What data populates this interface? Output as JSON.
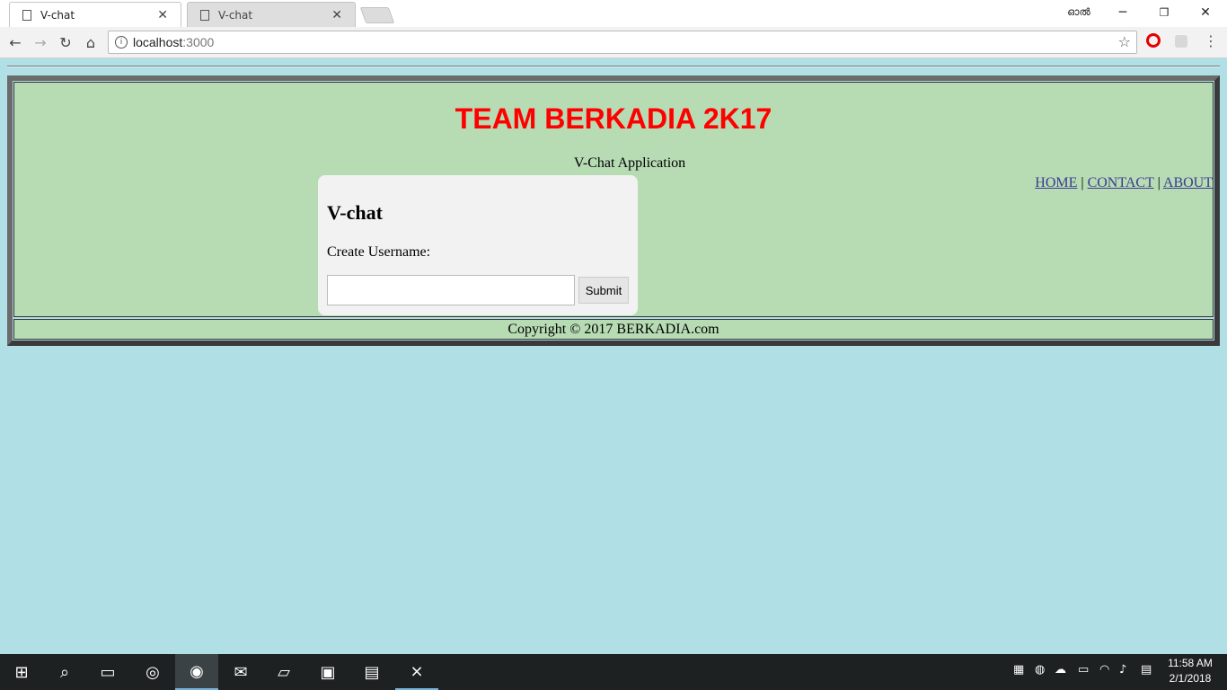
{
  "browser": {
    "tabs": [
      {
        "label": "V-chat",
        "active": true
      },
      {
        "label": "V-chat",
        "active": false
      }
    ],
    "profile_label": "ഓൽ",
    "address": {
      "host": "localhost",
      "port": ":3000"
    }
  },
  "page": {
    "title": "TEAM BERKADIA 2K17",
    "subtitle": "V-Chat Application",
    "nav": {
      "home": "HOME",
      "contact": "CONTACT",
      "about": "ABOUT",
      "separator": "|"
    },
    "card": {
      "heading": "V-chat",
      "label": "Create Username:",
      "input_value": "",
      "submit_label": "Submit"
    },
    "footer": "Copyright © 2017 BERKADIA.com"
  },
  "taskbar": {
    "time": "11:58 AM",
    "date": "2/1/2018"
  },
  "colors": {
    "page_background": "#b0dfe5",
    "panel_background": "#b7dcb4",
    "title_color": "#ff0000",
    "link_color": "#3b3b8f"
  }
}
